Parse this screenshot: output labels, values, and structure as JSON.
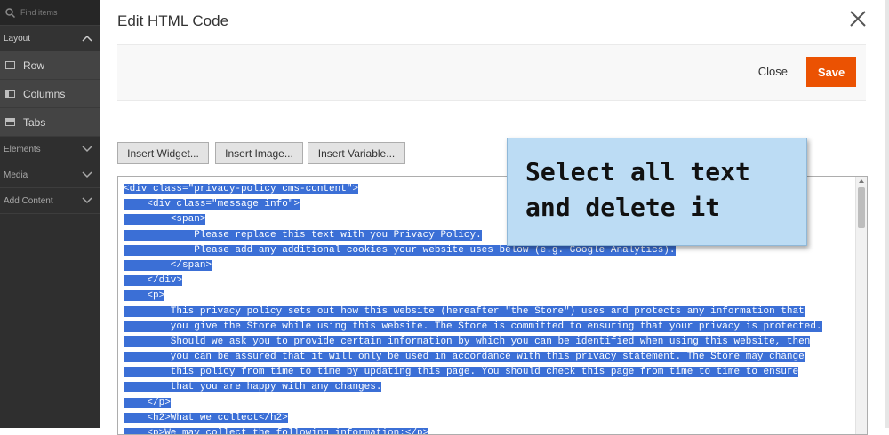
{
  "sidebar": {
    "search_placeholder": "Find items",
    "layout_label": "Layout",
    "items": [
      {
        "label": "Row",
        "icon": "row-icon"
      },
      {
        "label": "Columns",
        "icon": "columns-icon"
      },
      {
        "label": "Tabs",
        "icon": "tabs-icon"
      }
    ],
    "sections": [
      "Elements",
      "Media",
      "Add Content"
    ]
  },
  "modal": {
    "title": "Edit HTML Code",
    "close_label": "Close",
    "save_label": "Save",
    "insert_buttons": [
      "Insert Widget...",
      "Insert Image...",
      "Insert Variable..."
    ]
  },
  "editor": {
    "lines": [
      "<div class=\"privacy-policy cms-content\">",
      "    <div class=\"message info\">",
      "        <span>",
      "            Please replace this text with you Privacy Policy.",
      "            Please add any additional cookies your website uses below (e.g. Google Analytics).",
      "        </span>",
      "    </div>",
      "    <p>",
      "        This privacy policy sets out how this website (hereafter \"the Store\") uses and protects any information that",
      "        you give the Store while using this website. The Store is committed to ensuring that your privacy is protected.",
      "        Should we ask you to provide certain information by which you can be identified when using this website, then",
      "        you can be assured that it will only be used in accordance with this privacy statement. The Store may change",
      "        this policy from time to time by updating this page. You should check this page from time to time to ensure",
      "        that you are happy with any changes.",
      "    </p>",
      "    <h2>What we collect</h2>",
      "    <p>We may collect the following information:</p>"
    ]
  },
  "callout": {
    "line1": "Select all text",
    "line2": "and delete it"
  },
  "colors": {
    "accent": "#eb5202",
    "selection": "#3b6fd6",
    "callout_bg": "#bcdcf4",
    "sidebar_bg": "#2f2f2f"
  }
}
